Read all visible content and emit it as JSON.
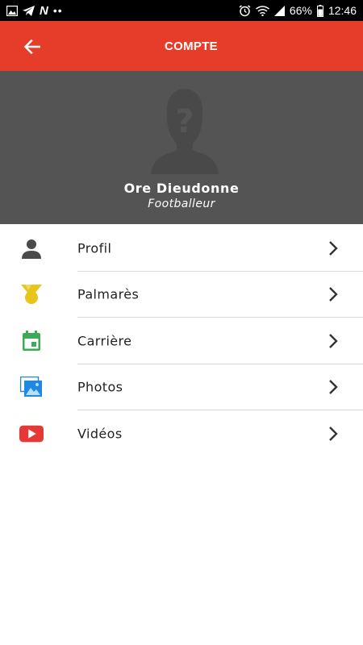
{
  "status_bar": {
    "battery": "66%",
    "time": "12:46",
    "left_icons": [
      "image-icon",
      "telegram-icon",
      "n-icon",
      "more-dots-icon"
    ],
    "right_icons": [
      "alarm-icon",
      "wifi-icon",
      "signal-icon",
      "battery-icon"
    ]
  },
  "app_bar": {
    "title": "COMPTE",
    "back_icon": "arrow-left-icon",
    "color": "#e53d29"
  },
  "profile": {
    "name": "Ore Dieudonne",
    "role": "Footballeur",
    "avatar_icon": "unknown-person-icon",
    "header_color": "#545454"
  },
  "menu": {
    "items": [
      {
        "label": "Profil",
        "icon": "person-icon",
        "icon_color": "#4a4a4a"
      },
      {
        "label": "Palmarès",
        "icon": "medal-icon",
        "icon_color": "#e8c51a"
      },
      {
        "label": "Carrière",
        "icon": "calendar-icon",
        "icon_color": "#3daa5a"
      },
      {
        "label": "Photos",
        "icon": "photos-icon",
        "icon_color": "#1e88e5"
      },
      {
        "label": "Vidéos",
        "icon": "youtube-icon",
        "icon_color": "#e53935"
      }
    ],
    "chevron_icon": "chevron-right-icon"
  }
}
